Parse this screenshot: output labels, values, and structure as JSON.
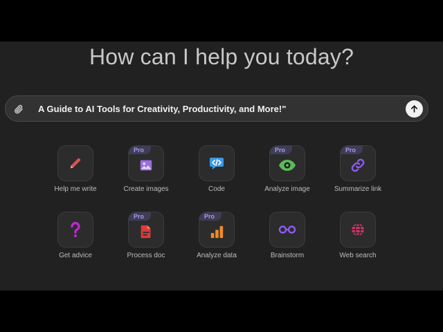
{
  "headline": "How can I help you today?",
  "prompt": {
    "text": "A Guide to AI Tools for Creativity, Productivity, and More!\"",
    "attach_icon": "paperclip-icon",
    "send_icon": "arrow-up-icon"
  },
  "tools": [
    {
      "label": "Help me write",
      "icon": "pencil-icon",
      "pro": false,
      "color": "#d9534f"
    },
    {
      "label": "Create images",
      "icon": "image-icon",
      "pro": true,
      "color": "#9a6fe0"
    },
    {
      "label": "Code",
      "icon": "code-icon",
      "pro": false,
      "color": "#3b9ae8"
    },
    {
      "label": "Analyze image",
      "icon": "eye-icon",
      "pro": true,
      "color": "#5cb85c"
    },
    {
      "label": "Summarize link",
      "icon": "link-icon",
      "pro": true,
      "color": "#8b5cf6"
    },
    {
      "label": "Get advice",
      "icon": "question-icon",
      "pro": false,
      "color": "#c026d3"
    },
    {
      "label": "Process doc",
      "icon": "document-icon",
      "pro": true,
      "color": "#e03a3a"
    },
    {
      "label": "Analyze data",
      "icon": "bar-chart-icon",
      "pro": true,
      "color": "#f08c2a"
    },
    {
      "label": "Brainstorm",
      "icon": "glasses-icon",
      "pro": false,
      "color": "#8b5cf6"
    },
    {
      "label": "Web search",
      "icon": "globe-icon",
      "pro": false,
      "color": "#d6336c"
    }
  ],
  "pro_label": "Pro"
}
